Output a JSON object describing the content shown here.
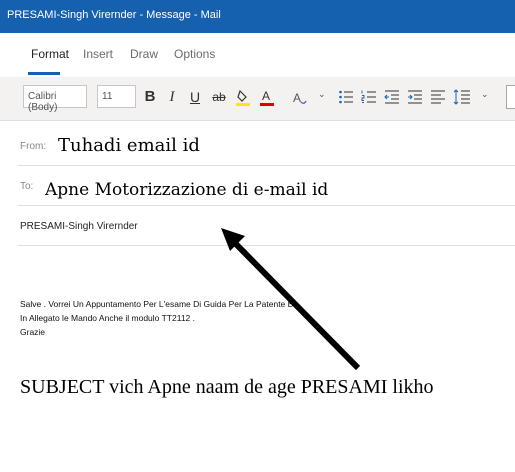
{
  "window": {
    "title": "PRESAMI-Singh Virernder - Message - Mail"
  },
  "tabs": [
    {
      "label": "Format"
    },
    {
      "label": "Insert"
    },
    {
      "label": "Draw"
    },
    {
      "label": "Options"
    }
  ],
  "toolbar": {
    "font": "Calibri (Body)",
    "size": "11",
    "bold": "B",
    "italic": "I",
    "underline": "U",
    "strike": "ab"
  },
  "from": {
    "label": "From:",
    "value": "Tuhadi email id"
  },
  "to": {
    "label": "To:",
    "value": "Apne Motorizzazione di e-mail id"
  },
  "subject": {
    "value": "PRESAMI-Singh Virernder"
  },
  "body": {
    "lines": [
      "Salve . Vorrei Un Appuntamento Per L'esame Di Guida Per La Patente B.",
      "In Allegato le Mando Anche il modulo TT2112 .",
      "Grazie"
    ]
  },
  "annotation": {
    "text": "SUBJECT vich Apne naam de age PRESAMI likho"
  },
  "colors": {
    "accent": "#1660b0",
    "highlight": "#ffe800",
    "font_color": "#e00000"
  },
  "icons": [
    "highlighter-icon",
    "font-color-icon",
    "clear-format-icon",
    "bullets-icon",
    "numbering-icon",
    "decrease-indent-icon",
    "increase-indent-icon",
    "align-icon",
    "line-spacing-icon"
  ]
}
